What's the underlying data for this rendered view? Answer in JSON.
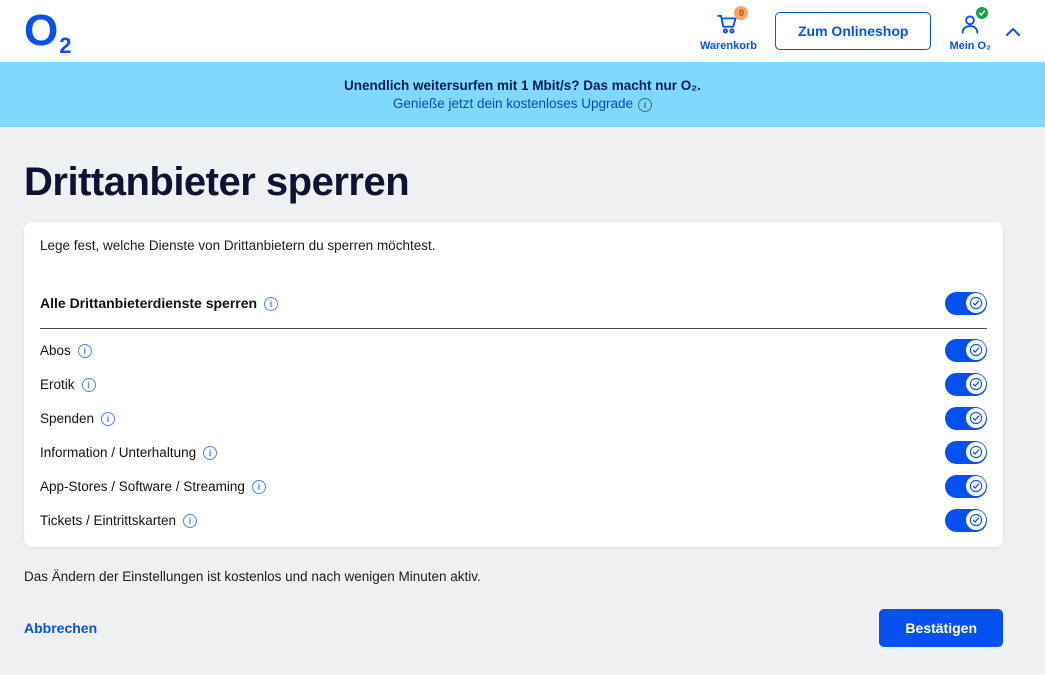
{
  "header": {
    "logo_o": "O",
    "logo_sub": "2",
    "cart": {
      "label": "Warenkorb",
      "badge": "0"
    },
    "shop_button_label": "Zum Onlineshop",
    "account": {
      "label": "Mein O₂"
    }
  },
  "banner": {
    "line1": "Unendlich weitersurfen mit 1 Mbit/s? Das macht nur O₂.",
    "line2": "Genieße jetzt dein kostenloses Upgrade"
  },
  "page": {
    "title": "Drittanbieter sperren",
    "intro": "Lege fest, welche Dienste von Drittanbietern du sperren möchtest.",
    "master_toggle": {
      "label": "Alle Drittanbieterdienste sperren",
      "enabled": true
    },
    "categories": [
      {
        "label": "Abos",
        "enabled": true
      },
      {
        "label": "Erotik",
        "enabled": true
      },
      {
        "label": "Spenden",
        "enabled": true
      },
      {
        "label": "Information / Unterhaltung",
        "enabled": true
      },
      {
        "label": "App-Stores / Software / Streaming",
        "enabled": true
      },
      {
        "label": "Tickets / Eintrittskarten",
        "enabled": true
      }
    ],
    "note": "Das Ändern der Einstellungen ist kostenlos und nach wenigen Minuten aktiv.",
    "cancel_label": "Abbrechen",
    "confirm_label": "Bestätigen"
  },
  "colors": {
    "brand_blue": "#0551F0",
    "banner_background": "#7FD9FA",
    "banner_headline_navy": "#001E5A",
    "page_background": "#EFF0F2",
    "cart_badge_orange": "#F8A566",
    "account_badge_green": "#16A24B"
  },
  "icons": {
    "cart": "cart-icon",
    "user": "user-icon",
    "chevron": "chevron-up-icon",
    "info": "info-icon",
    "check": "check-icon"
  }
}
